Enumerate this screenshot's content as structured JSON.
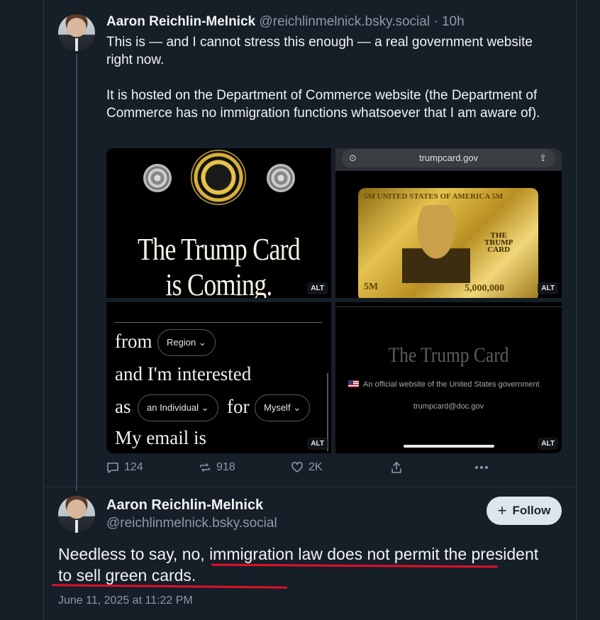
{
  "post1": {
    "author_name": "Aaron Reichlin-Melnick",
    "handle_time": "@reichlinmelnick.bsky.social · 10h",
    "text_p1": "This is — and I cannot stress this enough — a real government website right now.",
    "text_p2": "It is hosted on the Department of Commerce website (the Department of Commerce has no immigration functions whatsoever that I am aware of).",
    "images": {
      "img1_title_line1": "The Trump Card",
      "img1_title_line2": "is Coming.",
      "img2_url": "trumpcard.gov",
      "img2_card_header": "5M UNITED STATES OF AMERICA 5M",
      "img2_card_label_line1": "THE",
      "img2_card_label_line2": "TRUMP",
      "img2_card_label_line3": "CARD",
      "img2_card_amount_left": "5M",
      "img2_card_amount_right": "5,000,000",
      "img3_from": "from",
      "img3_region": "Region",
      "img3_interested": "and I'm interested",
      "img3_as": "as",
      "img3_individual": "an Individual",
      "img3_for": "for",
      "img3_myself": "Myself",
      "img3_email": "My email is",
      "img4_title": "The Trump Card",
      "img4_official": "An official website of the United States government",
      "img4_email": "trumpcard@doc.gov",
      "alt_label": "ALT"
    },
    "actions": {
      "replies": "124",
      "reposts": "918",
      "likes": "2K"
    }
  },
  "post2": {
    "author_name": "Aaron Reichlin-Melnick",
    "handle": "@reichlinmelnick.bsky.social",
    "follow_label": "Follow",
    "text": "Needless to say, no, immigration law does not permit the president to sell green cards.",
    "date": "June 11, 2025 at 11:22 PM"
  },
  "colors": {
    "background": "#161e27",
    "muted_text": "#8c9aa8",
    "underline_red": "#e0102a",
    "follow_bg": "#dfe5ec"
  }
}
